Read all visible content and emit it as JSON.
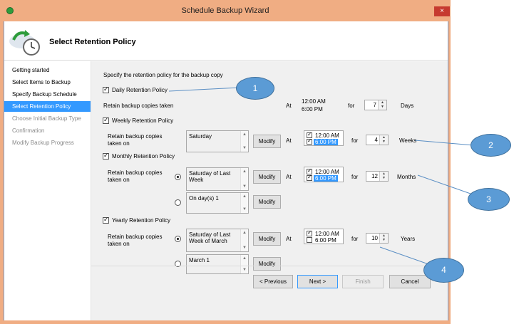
{
  "window": {
    "title": "Schedule Backup Wizard",
    "close_glyph": "×"
  },
  "header": {
    "title": "Select Retention Policy"
  },
  "nav": {
    "items": [
      {
        "label": "Getting started"
      },
      {
        "label": "Select Items to Backup"
      },
      {
        "label": "Specify Backup Schedule"
      },
      {
        "label": "Select Retention Policy"
      },
      {
        "label": "Choose Initial Backup Type"
      },
      {
        "label": "Confirmation"
      },
      {
        "label": "Modify Backup Progress"
      }
    ]
  },
  "content": {
    "instruction": "Specify the retention policy for the backup copy",
    "common": {
      "at": "At",
      "for": "for",
      "modify": "Modify"
    },
    "daily": {
      "label": "Daily Retention Policy",
      "retain_label": "Retain backup copies taken",
      "time1": "12:00 AM",
      "time2": "6:00 PM",
      "value": "7",
      "unit": "Days"
    },
    "weekly": {
      "label": "Weekly Retention Policy",
      "retain_label1": "Retain backup copies",
      "retain_label2": "taken on",
      "list_value": "Saturday",
      "time1": "12:00 AM",
      "time2": "6:00 PM",
      "value": "4",
      "unit": "Weeks"
    },
    "monthly": {
      "label": "Monthly Retention Policy",
      "retain_label1": "Retain backup copies",
      "retain_label2": "taken on",
      "list1_value": "Saturday of Last Week",
      "list2_value": "On day(s) 1",
      "time1": "12:00 AM",
      "time2": "6:00 PM",
      "value": "12",
      "unit": "Months"
    },
    "yearly": {
      "label": "Yearly Retention Policy",
      "retain_label1": "Retain backup copies",
      "retain_label2": "taken on",
      "list1_value": "Saturday of Last Week of March",
      "list2_value": "March 1",
      "time1": "12:00 AM",
      "time2": "6:00 PM",
      "value": "10",
      "unit": "Years"
    }
  },
  "footer": {
    "previous": "< Previous",
    "next": "Next >",
    "finish": "Finish",
    "cancel": "Cancel"
  },
  "callouts": [
    {
      "label": "1"
    },
    {
      "label": "2"
    },
    {
      "label": "3"
    },
    {
      "label": "4"
    }
  ],
  "colors": {
    "titlebar": "#f0ad83",
    "selection": "#3399ff",
    "callout": "#5b9bd5",
    "close": "#c63a2f"
  }
}
